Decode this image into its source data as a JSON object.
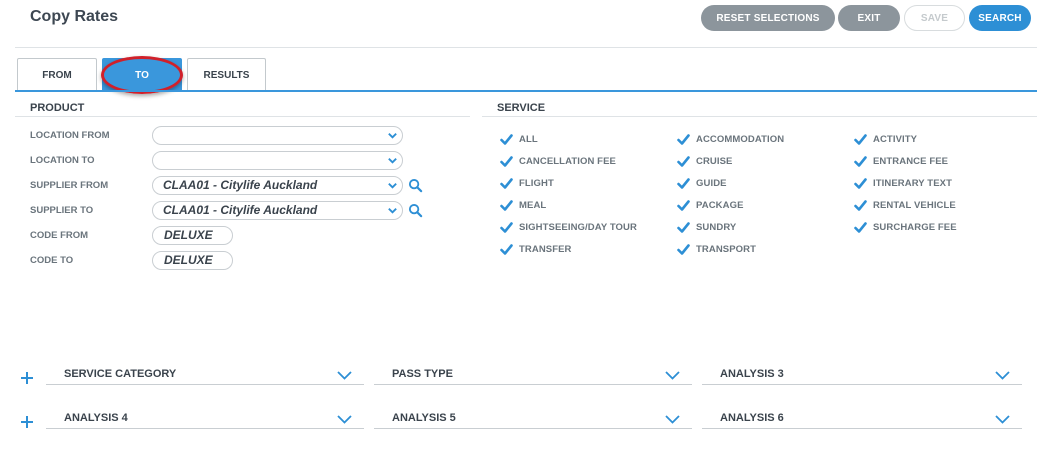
{
  "page": {
    "title": "Copy Rates"
  },
  "toolbar": {
    "reset": "RESET SELECTIONS",
    "exit": "EXIT",
    "save": "SAVE",
    "search": "SEARCH"
  },
  "tabs": [
    {
      "label": "FROM",
      "active": false
    },
    {
      "label": "TO",
      "active": true
    },
    {
      "label": "RESULTS",
      "active": false
    }
  ],
  "product": {
    "title": "PRODUCT",
    "location_from_label": "LOCATION FROM",
    "location_from_value": "",
    "location_to_label": "LOCATION TO",
    "location_to_value": "",
    "supplier_from_label": "SUPPLIER FROM",
    "supplier_from_value": "CLAA01 - Citylife Auckland",
    "supplier_to_label": "SUPPLIER TO",
    "supplier_to_value": "CLAA01 - Citylife Auckland",
    "code_from_label": "CODE FROM",
    "code_from_value": "DELUXE",
    "code_to_label": "CODE TO",
    "code_to_value": "DELUXE"
  },
  "service": {
    "title": "SERVICE",
    "items": [
      {
        "label": "ALL",
        "checked": true
      },
      {
        "label": "ACCOMMODATION",
        "checked": true
      },
      {
        "label": "ACTIVITY",
        "checked": true
      },
      {
        "label": "CANCELLATION FEE",
        "checked": true
      },
      {
        "label": "CRUISE",
        "checked": true
      },
      {
        "label": "ENTRANCE FEE",
        "checked": true
      },
      {
        "label": "FLIGHT",
        "checked": true
      },
      {
        "label": "GUIDE",
        "checked": true
      },
      {
        "label": "ITINERARY TEXT",
        "checked": true
      },
      {
        "label": "MEAL",
        "checked": true
      },
      {
        "label": "PACKAGE",
        "checked": true
      },
      {
        "label": "RENTAL VEHICLE",
        "checked": true
      },
      {
        "label": "SIGHTSEEING/DAY TOUR",
        "checked": true
      },
      {
        "label": "SUNDRY",
        "checked": true
      },
      {
        "label": "SURCHARGE FEE",
        "checked": true
      },
      {
        "label": "TRANSFER",
        "checked": true
      },
      {
        "label": "TRANSPORT",
        "checked": true
      }
    ]
  },
  "filters": {
    "row1": [
      "SERVICE CATEGORY",
      "PASS TYPE",
      "ANALYSIS 3"
    ],
    "row2": [
      "ANALYSIS 4",
      "ANALYSIS 5",
      "ANALYSIS 6"
    ]
  },
  "colors": {
    "accent": "#3a97dc",
    "button_grey": "#8c959c",
    "highlight": "#d0202a"
  },
  "icons": {
    "dropdown": "chevron-down-icon",
    "search": "search-icon",
    "checkbox": "check-icon",
    "expand": "plus-icon"
  }
}
